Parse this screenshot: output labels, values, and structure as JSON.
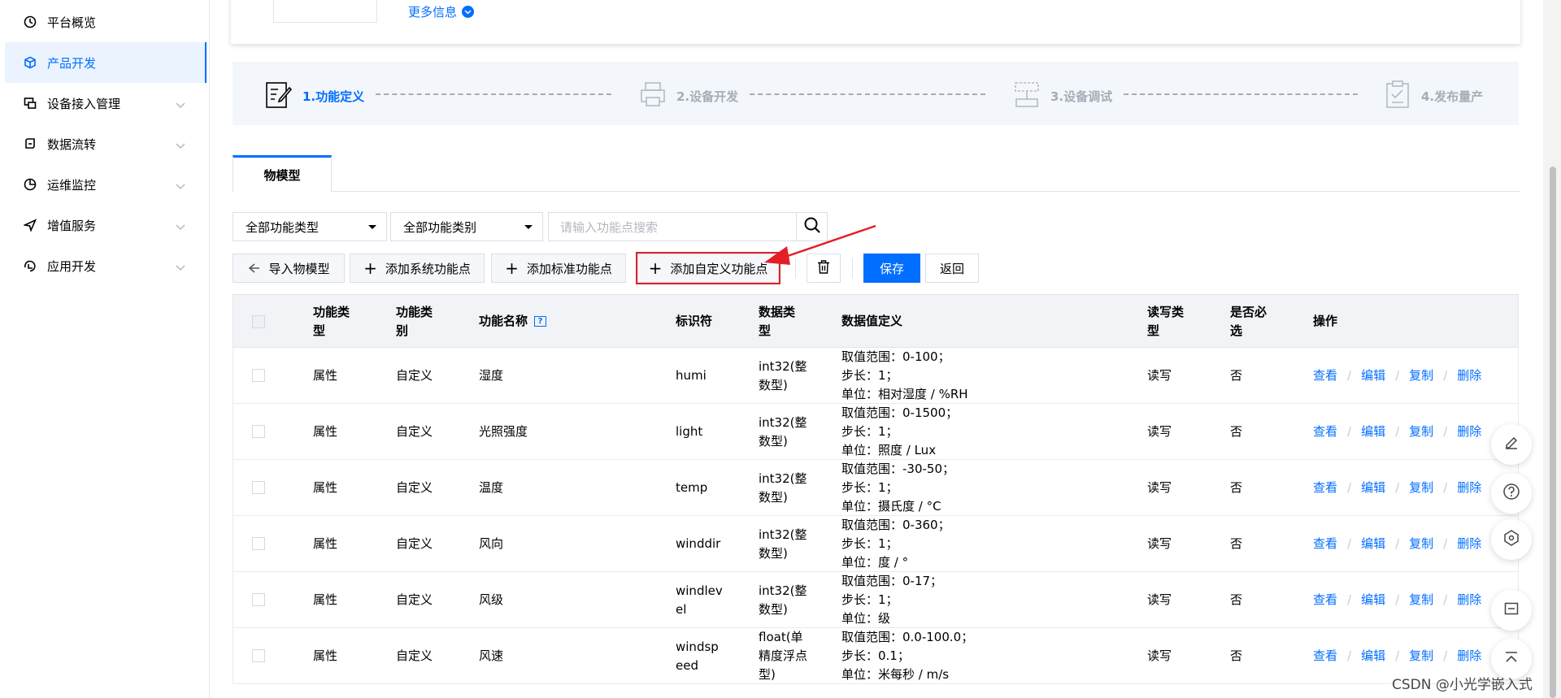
{
  "sidebar": {
    "items": [
      {
        "label": "平台概览",
        "icon": "overview-icon",
        "active": false,
        "expandable": false
      },
      {
        "label": "产品开发",
        "icon": "cube-icon",
        "active": true,
        "expandable": false
      },
      {
        "label": "设备接入管理",
        "icon": "device-icon",
        "active": false,
        "expandable": true
      },
      {
        "label": "数据流转",
        "icon": "dataflow-icon",
        "active": false,
        "expandable": true
      },
      {
        "label": "运维监控",
        "icon": "monitor-icon",
        "active": false,
        "expandable": true
      },
      {
        "label": "增值服务",
        "icon": "send-icon",
        "active": false,
        "expandable": true
      },
      {
        "label": "应用开发",
        "icon": "app-icon",
        "active": false,
        "expandable": true
      }
    ]
  },
  "header": {
    "more_info": "更多信息"
  },
  "steps": [
    {
      "label": "1.功能定义",
      "state": "active",
      "icon": "document-edit-icon"
    },
    {
      "label": "2.设备开发",
      "state": "pending",
      "icon": "printer-icon"
    },
    {
      "label": "3.设备调试",
      "state": "pending",
      "icon": "debug-icon"
    },
    {
      "label": "4.发布量产",
      "state": "pending",
      "icon": "checklist-icon"
    }
  ],
  "tab": {
    "label": "物模型"
  },
  "filters": {
    "type_select": "全部功能类型",
    "category_select": "全部功能类别",
    "search_placeholder": "请输入功能点搜索"
  },
  "toolbar": {
    "import_label": "导入物模型",
    "add_system_label": "添加系统功能点",
    "add_standard_label": "添加标准功能点",
    "add_custom_label": "添加自定义功能点",
    "save_label": "保存",
    "back_label": "返回"
  },
  "table": {
    "headers": {
      "func_type": "功能类型",
      "func_category": "功能类别",
      "func_name": "功能名称",
      "identifier": "标识符",
      "data_type": "数据类型",
      "data_def": "数据值定义",
      "rw_type": "读写类型",
      "required": "是否必选",
      "actions": "操作"
    },
    "actions": {
      "view": "查看",
      "edit": "编辑",
      "copy": "复制",
      "delete": "删除"
    },
    "rows": [
      {
        "type": "属性",
        "category": "自定义",
        "name": "湿度",
        "identifier": "humi",
        "data_type": "int32(整数型)",
        "range": "取值范围：0-100；",
        "step": "步长：1；",
        "unit": "单位：相对湿度 / %RH",
        "rw": "读写",
        "required": "否"
      },
      {
        "type": "属性",
        "category": "自定义",
        "name": "光照强度",
        "identifier": "light",
        "data_type": "int32(整数型)",
        "range": "取值范围：0-1500；",
        "step": "步长：1；",
        "unit": "单位：照度 / Lux",
        "rw": "读写",
        "required": "否"
      },
      {
        "type": "属性",
        "category": "自定义",
        "name": "温度",
        "identifier": "temp",
        "data_type": "int32(整数型)",
        "range": "取值范围：-30-50；",
        "step": "步长：1；",
        "unit": "单位：摄氏度 / °C",
        "rw": "读写",
        "required": "否"
      },
      {
        "type": "属性",
        "category": "自定义",
        "name": "风向",
        "identifier": "winddir",
        "data_type": "int32(整数型)",
        "range": "取值范围：0-360；",
        "step": "步长：1；",
        "unit": "单位：度 / °",
        "rw": "读写",
        "required": "否"
      },
      {
        "type": "属性",
        "category": "自定义",
        "name": "风级",
        "identifier": "windlevel",
        "data_type": "int32(整数型)",
        "range": "取值范围：0-17；",
        "step": "步长：1；",
        "unit": "单位：级",
        "rw": "读写",
        "required": "否"
      },
      {
        "type": "属性",
        "category": "自定义",
        "name": "风速",
        "identifier": "windspeed",
        "data_type": "float(单精度浮点型)",
        "range": "取值范围：0.0-100.0；",
        "step": "步长：0.1；",
        "unit": "单位：米每秒 / m/s",
        "rw": "读写",
        "required": "否"
      }
    ]
  },
  "floating_tools": [
    "edit-icon",
    "help-icon",
    "scan-icon",
    "minimize-icon",
    "back-to-top-icon"
  ],
  "watermark": "CSDN @小光学嵌入式",
  "colors": {
    "accent": "#006eff",
    "highlight_border": "#e21f26"
  }
}
